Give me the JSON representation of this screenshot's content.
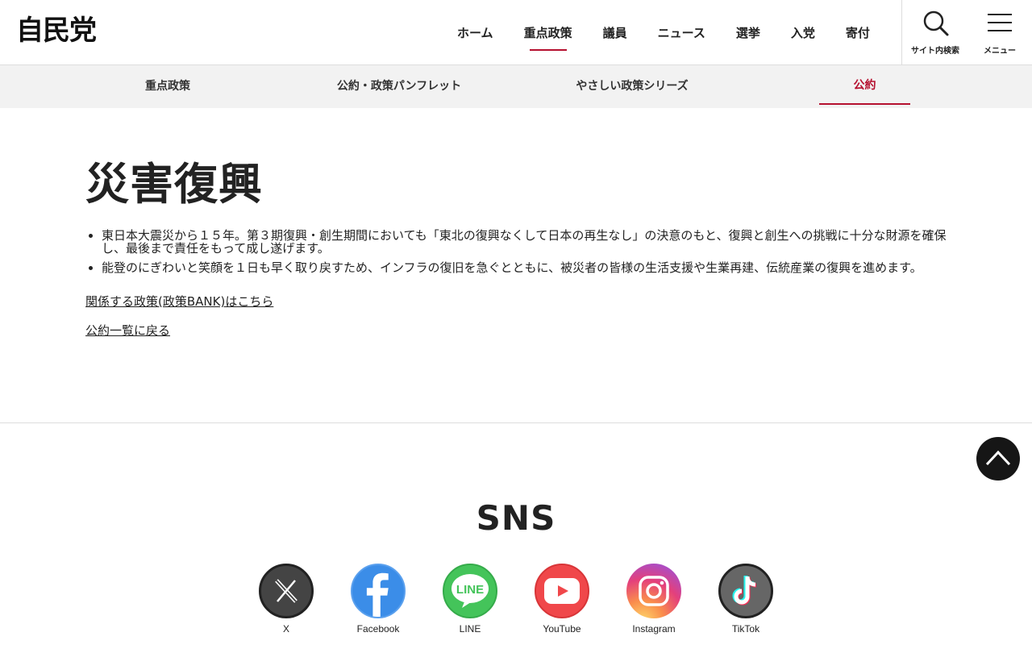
{
  "header": {
    "logo": "自民党",
    "nav": [
      "ホーム",
      "重点政策",
      "議員",
      "ニュース",
      "選挙",
      "入党",
      "寄付"
    ],
    "search_label": "サイト内検索",
    "menu_label": "メニュー"
  },
  "subnav": [
    "重点政策",
    "公約・政策パンフレット",
    "やさしい政策シリーズ",
    "公約"
  ],
  "main": {
    "title": "災害復興",
    "bullets": [
      "東日本大震災から１５年。第３期復興・創生期間においても「東北の復興なくして日本の再生なし」の決意のもと、復興と創生への挑戦に十分な財源を確保し、最後まで責任をもって成し遂げます。",
      "能登のにぎわいと笑顔を１日も早く取り戻すため、インフラの復旧を急ぐとともに、被災者の皆様の生活支援や生業再建、伝統産業の復興を進めます。"
    ],
    "related_link": "関係する政策(政策BANK)はこちら",
    "back_link": "公約一覧に戻る"
  },
  "sns": {
    "title": "SNS",
    "items": [
      "X",
      "Facebook",
      "LINE",
      "YouTube",
      "Instagram",
      "TikTok"
    ]
  },
  "colors": {
    "accent": "#b5102f"
  }
}
